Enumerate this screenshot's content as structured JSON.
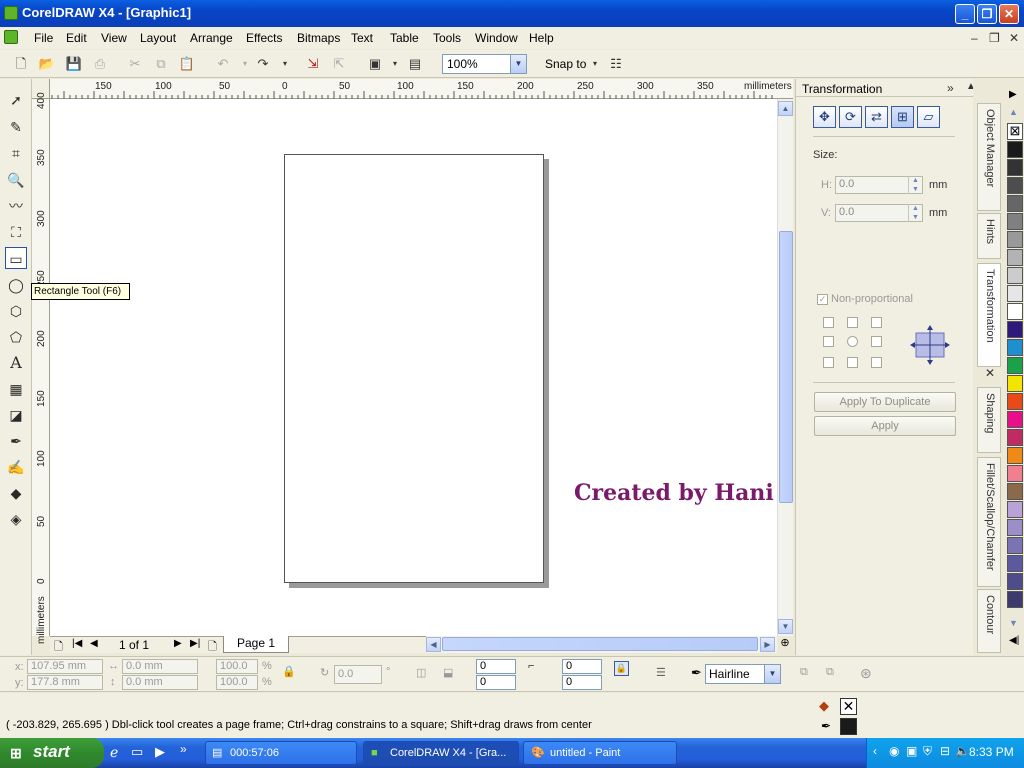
{
  "window": {
    "title": "CorelDRAW X4 - [Graphic1]"
  },
  "menu": [
    "File",
    "Edit",
    "View",
    "Layout",
    "Arrange",
    "Effects",
    "Bitmaps",
    "Text",
    "Table",
    "Tools",
    "Window",
    "Help"
  ],
  "toolbar": {
    "zoom_value": "100%",
    "snap_label": "Snap to"
  },
  "tooltip": "Rectangle Tool (F6)",
  "ruler": {
    "units": "millimeters",
    "h_labels": [
      "150",
      "100",
      "50",
      "0",
      "50",
      "100",
      "150",
      "200",
      "250",
      "300",
      "350"
    ],
    "v_labels": [
      "400",
      "350",
      "300",
      "250",
      "200",
      "150",
      "100",
      "50",
      "0"
    ],
    "v_units": "millimeters"
  },
  "canvas": {
    "watermark": "Created by Hani"
  },
  "page_nav": {
    "counter": "1 of 1",
    "tab": "Page 1"
  },
  "docker": {
    "title": "Transformation",
    "size_label": "Size:",
    "h_label": "H:",
    "h_value": "0.0",
    "h_unit": "mm",
    "v_label": "V:",
    "v_value": "0.0",
    "v_unit": "mm",
    "nonprop_label": "Non-proportional",
    "apply_dup_label": "Apply To Duplicate",
    "apply_label": "Apply"
  },
  "side_tabs": [
    "Object Manager",
    "Hints",
    "Transformation",
    "Shaping",
    "Fillet/Scallop/Chamfer",
    "Contour"
  ],
  "palette": [
    "#1a1a1a",
    "#333333",
    "#4d4d4d",
    "#666666",
    "#808080",
    "#999999",
    "#b3b3b3",
    "#cccccc",
    "#e6e6e6",
    "#ffffff",
    "#2e1a7a",
    "#1e90d0",
    "#1aa24a",
    "#f2e600",
    "#e84a1a",
    "#e8108a",
    "#c02b63",
    "#f08a16",
    "#f08090",
    "#8a6a4a",
    "#b9a3d6",
    "#9c8fc9",
    "#7a74b5",
    "#5b5aa0",
    "#4f4c8c",
    "#3f3a6e"
  ],
  "propbar": {
    "x_label": "x:",
    "x_value": "107.95 mm",
    "y_label": "y:",
    "y_value": "177.8 mm",
    "w_value": "0.0 mm",
    "h_value": "0.0 mm",
    "sx_value": "100.0",
    "sy_value": "100.0",
    "pct": "%",
    "rot_value": "0.0",
    "deg": "°",
    "corner1": "0",
    "corner2": "0",
    "corner3": "0",
    "corner4": "0",
    "outline_value": "Hairline"
  },
  "status": {
    "text": "( -203.829, 265.695 )   Dbl-click tool creates a page frame; Ctrl+drag constrains to a square; Shift+drag draws from center"
  },
  "taskbar": {
    "start": "start",
    "tasks": [
      "000:57:06",
      "CorelDRAW X4 - [Gra...",
      "untitled - Paint"
    ],
    "clock": "8:33 PM"
  }
}
